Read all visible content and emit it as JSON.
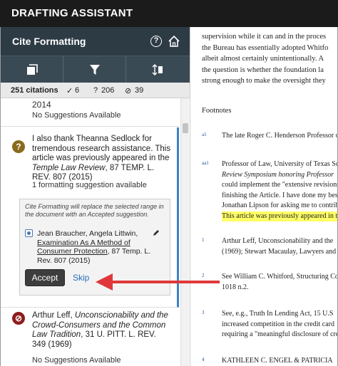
{
  "app": {
    "title": "DRAFTING ASSISTANT"
  },
  "sidebar": {
    "title": "Cite Formatting",
    "icons": [
      "help-icon",
      "home-icon"
    ],
    "toolbar": [
      "collapse-icon",
      "filter-icon",
      "sort-icon"
    ],
    "stats": {
      "citations": "251 citations",
      "ok": "6",
      "flagged": "206",
      "blocked": "39"
    }
  },
  "items": [
    {
      "year": "2014",
      "status": "No Suggestions Available"
    },
    {
      "badge": "?",
      "text_plain": "I also thank Theanna Sedlock for tremendous research assistance. This article was previously appeared in the ",
      "text_italic": "Temple Law Review",
      "text_rest": ", 87 TEMP. L. REV. 807 (2015)",
      "suggestion_count": "1 formatting suggestion available",
      "panel": {
        "note": "Cite Formatting will replace the selected range in the document with an Accepted suggestion.",
        "authors": "Jean Braucher, Angela Littwin,",
        "title": "Examination As A Method of Consumer Protection",
        "cite": ", 87 Temp. L. Rev. 807 (2015)",
        "accept": "Accept",
        "skip": "Skip"
      }
    },
    {
      "author": "Arthur Leff, ",
      "title": "Unconscionability and the Crowd-Consumers and the Common Law Tradition",
      "cite": ", 31 U. PITT. L. REV. 349 (1969)",
      "status": "No Suggestions Available"
    }
  ],
  "document": {
    "lines": [
      "supervision while it can and in the proces",
      "the Bureau has essentially adopted Whitfo",
      "albeit almost certainly unintentionally. A",
      "the question is whether the foundation la",
      "strong enough to make the oversight they"
    ],
    "footnotes_heading": "Footnotes",
    "footnotes": [
      {
        "num": "a1",
        "lines": [
          "The late Roger C. Henderson Professor o"
        ]
      },
      {
        "num": "aa1",
        "lines": [
          "Professor of Law, University of Texas Sc",
          "Review Symposium honoring Professor",
          "could implement the \"extensive revisions",
          "finishing the Article. I have done my bes",
          "Jonathan Lipson for asking me to contrib",
          "This article was previously appeared in th"
        ]
      },
      {
        "num": "1",
        "lines": [
          "Arthur Leff, Unconscionability and the",
          "(1969); Stewart Macaulay, Lawyers and"
        ]
      },
      {
        "num": "2",
        "lines": [
          "See William C. Whitford, Structuring Co",
          "1018 n.2."
        ]
      },
      {
        "num": "3",
        "lines": [
          "See, e.g., Truth In Lending Act, 15 U.S",
          "increased competition in the credit card",
          "requiring a \"meaningful disclosure of cre"
        ]
      },
      {
        "num": "4",
        "lines": [
          "KATHLEEN C. ENGEL & PATRICIA"
        ]
      }
    ]
  },
  "colors": {
    "topbar": "#1b1b1b",
    "sidebar_head": "#2d3b45",
    "accent": "#3a84c6",
    "arrow": "#e0383a",
    "highlight": "#ffff66"
  }
}
